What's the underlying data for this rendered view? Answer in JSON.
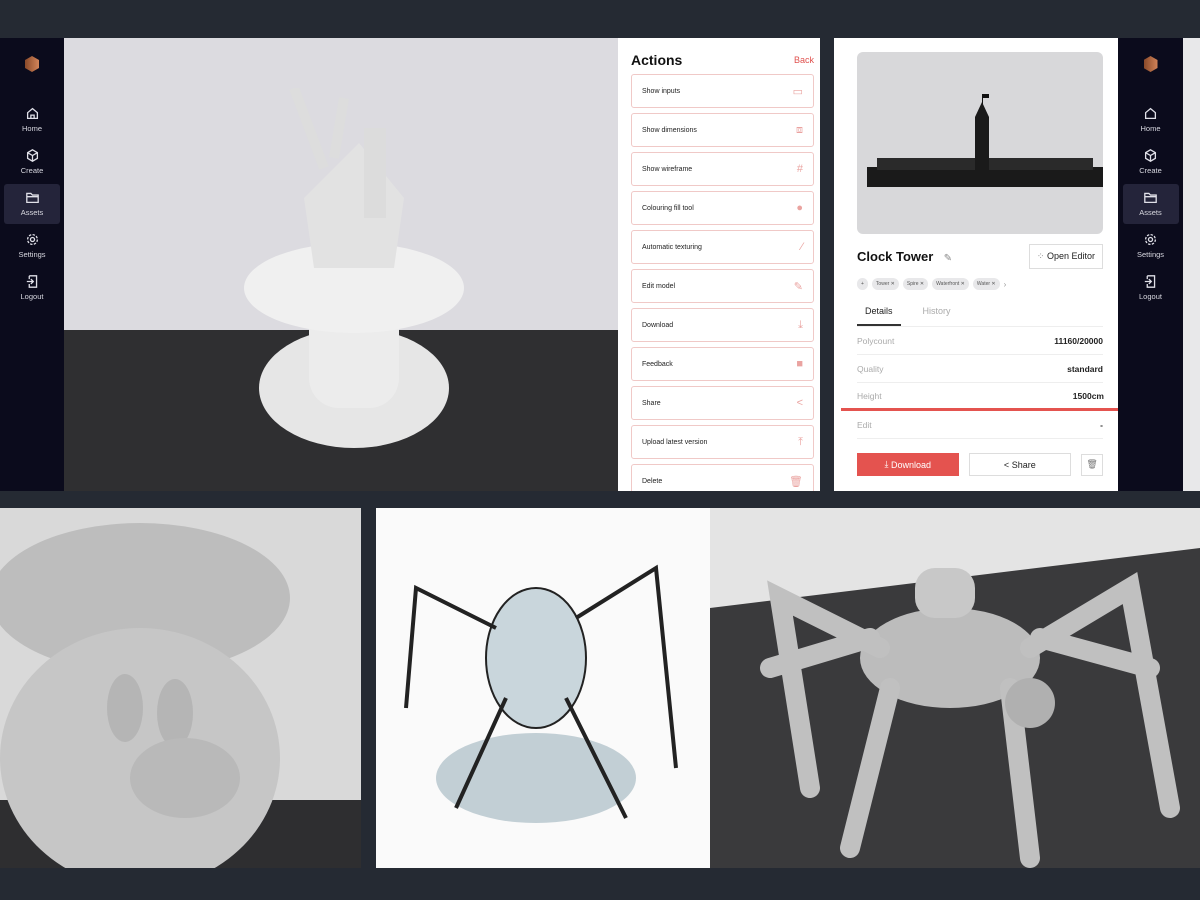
{
  "sidebar": {
    "items": [
      {
        "label": "Home",
        "icon": "home-icon"
      },
      {
        "label": "Create",
        "icon": "cube-icon"
      },
      {
        "label": "Assets",
        "icon": "folder-icon",
        "active": true
      },
      {
        "label": "Settings",
        "icon": "gear-icon"
      },
      {
        "label": "Logout",
        "icon": "logout-icon"
      }
    ]
  },
  "actions": {
    "title": "Actions",
    "back": "Back",
    "items": [
      {
        "label": "Show inputs",
        "icon": "image-icon",
        "glyph": "▭"
      },
      {
        "label": "Show dimensions",
        "icon": "dimensions-icon",
        "glyph": "⧈"
      },
      {
        "label": "Show wireframe",
        "icon": "hash-icon",
        "glyph": "#"
      },
      {
        "label": "Colouring fill tool",
        "icon": "palette-icon",
        "glyph": "●"
      },
      {
        "label": "Automatic texturing",
        "icon": "brush-icon",
        "glyph": "⁄"
      },
      {
        "label": "Edit model",
        "icon": "pencil-icon",
        "glyph": "✎"
      },
      {
        "label": "Download",
        "icon": "download-icon",
        "glyph": "⤓"
      },
      {
        "label": "Feedback",
        "icon": "feedback-icon",
        "glyph": "■"
      },
      {
        "label": "Share",
        "icon": "share-icon",
        "glyph": "<"
      },
      {
        "label": "Upload latest version",
        "icon": "upload-icon",
        "glyph": "⤒"
      },
      {
        "label": "Delete",
        "icon": "trash-icon",
        "glyph": "🗑"
      }
    ]
  },
  "detail": {
    "title": "Clock Tower",
    "open_editor": "Open Editor",
    "tags": [
      "Tower",
      "Spire",
      "Waterfront",
      "Water"
    ],
    "tabs": [
      "Details",
      "History"
    ],
    "rows": [
      {
        "k": "Polycount",
        "v": "11160/20000"
      },
      {
        "k": "Quality",
        "v": "standard"
      },
      {
        "k": "Height",
        "v": "1500cm"
      },
      {
        "k": "Edit",
        "v": "-"
      }
    ],
    "download": "Download",
    "share": "Share",
    "accent": "#e4534f"
  }
}
